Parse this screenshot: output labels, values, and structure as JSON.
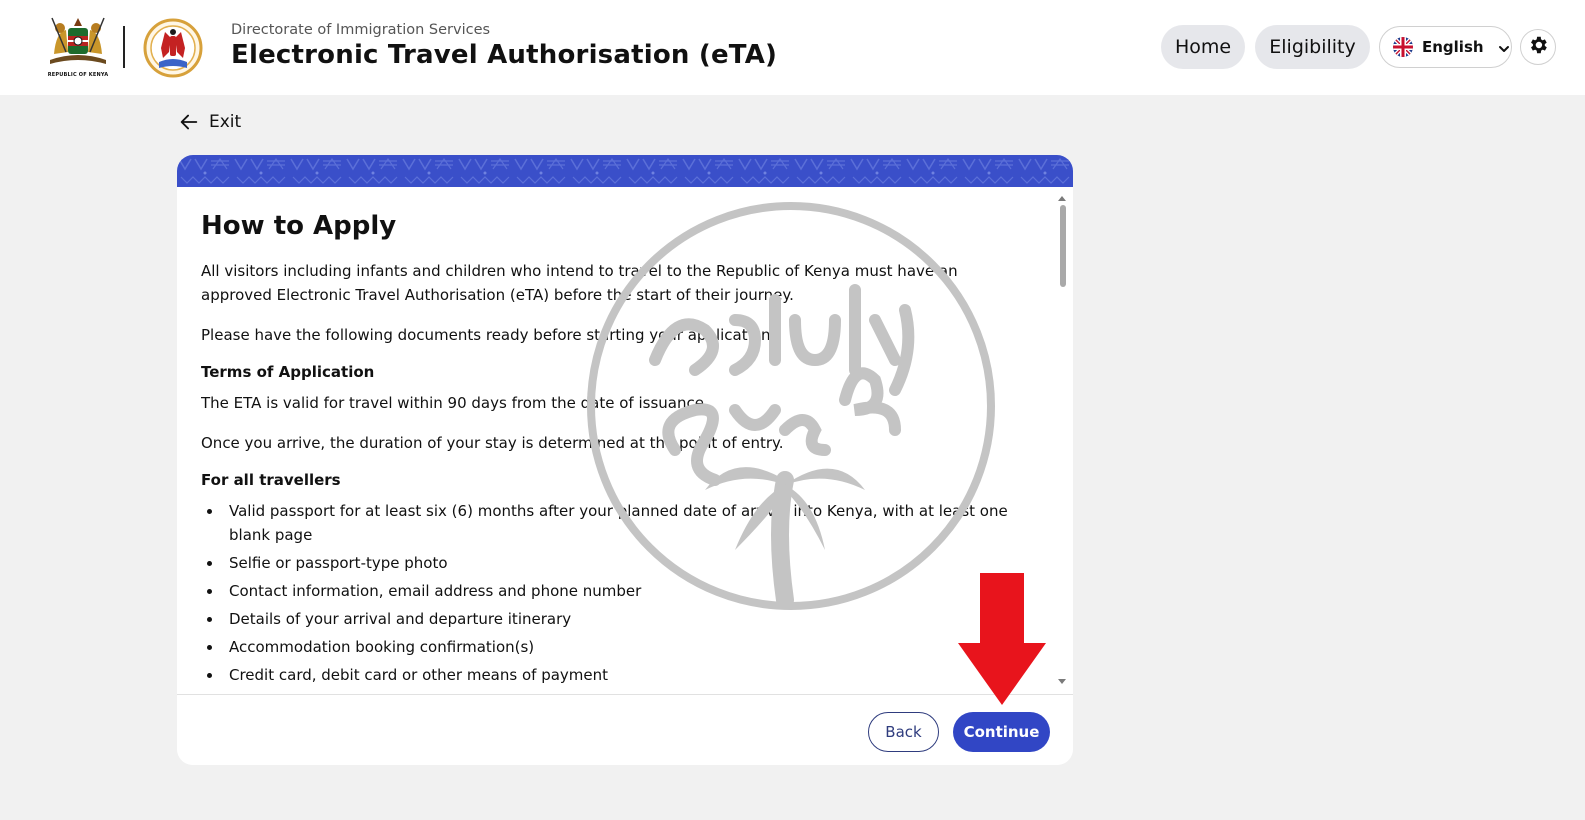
{
  "header": {
    "coat_caption": "REPUBLIC OF KENYA",
    "agency": "Directorate of Immigration Services",
    "title": "Electronic Travel Authorisation (eTA)",
    "nav": {
      "home": "Home",
      "eligibility": "Eligibility"
    },
    "language": {
      "label": "English",
      "flag_icon": "uk-flag-icon"
    },
    "settings_icon": "gear-icon"
  },
  "exit": {
    "label": "Exit",
    "icon": "arrow-left-icon"
  },
  "card": {
    "heading": "How to Apply",
    "intro": "All visitors including infants and children who intend to travel to the Republic of Kenya must have an approved Electronic Travel Authorisation (eTA) before the start of their journey.",
    "documents_note": "Please have the following documents ready before starting your application.",
    "terms_heading": "Terms of Application",
    "validity": "The ETA is valid for travel within 90 days from the date of issuance.",
    "duration": "Once you arrive, the duration of your stay is determined at the point of entry.",
    "all_travellers_heading": "For all travellers",
    "requirements": [
      "Valid passport for at least six (6) months after your planned date of arrival into Kenya, with at least one blank page",
      "Selfie or passport-type photo",
      "Contact information, email address and phone number",
      "Details of your arrival and departure itinerary",
      "Accommodation booking confirmation(s)",
      "Credit card, debit card or other means of payment"
    ],
    "buttons": {
      "back": "Back",
      "continue": "Continue"
    }
  },
  "colors": {
    "primary": "#3146c5",
    "banner": "#3a4fc9",
    "nav_pill": "#e6e7eb",
    "page_bg": "#f1f1f1",
    "annotation_arrow": "#e8141c",
    "watermark": "#bdbdbd"
  }
}
